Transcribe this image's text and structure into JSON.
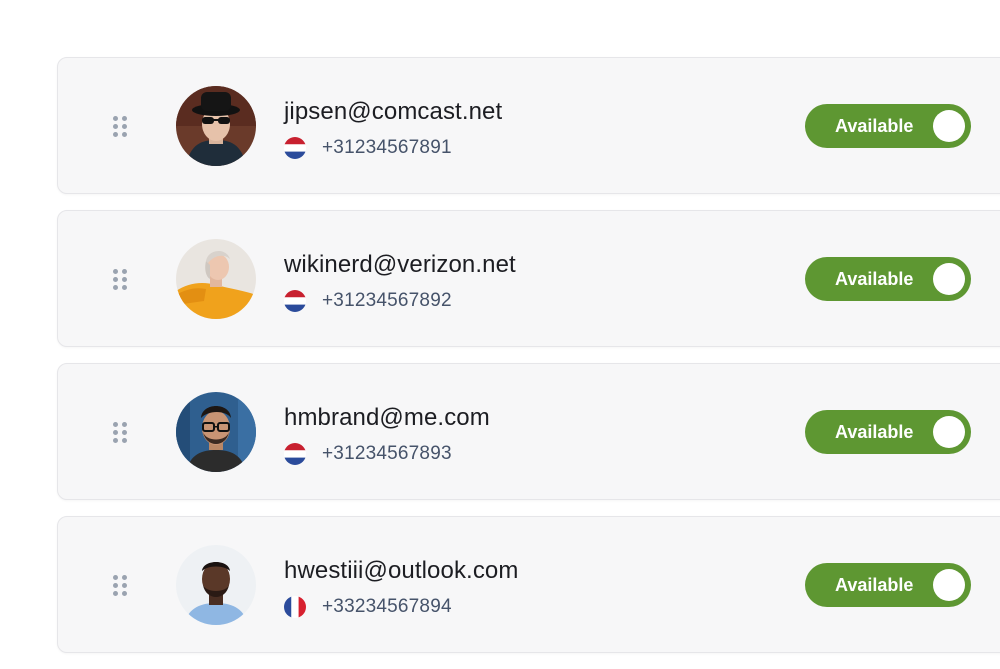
{
  "contacts": [
    {
      "email": "jipsen@comcast.net",
      "phone": "+31234567891",
      "country_flag": "netherlands-flag-icon",
      "status_label": "Available",
      "status_on": true,
      "avatar": "avatar-man-hat-sunglasses"
    },
    {
      "email": "wikinerd@verizon.net",
      "phone": "+31234567892",
      "country_flag": "netherlands-flag-icon",
      "status_label": "Available",
      "status_on": true,
      "avatar": "avatar-woman-yellow-sweater"
    },
    {
      "email": "hmbrand@me.com",
      "phone": "+31234567893",
      "country_flag": "netherlands-flag-icon",
      "status_label": "Available",
      "status_on": true,
      "avatar": "avatar-man-glasses-beard"
    },
    {
      "email": "hwestiii@outlook.com",
      "phone": "+33234567894",
      "country_flag": "france-flag-icon",
      "status_label": "Available",
      "status_on": true,
      "avatar": "avatar-man-blue-shirt"
    }
  ],
  "colors": {
    "toggle_on": "#5e9732",
    "card_bg": "#f7f7f8",
    "email_text": "#1c1d22",
    "phone_text": "#46536a"
  }
}
